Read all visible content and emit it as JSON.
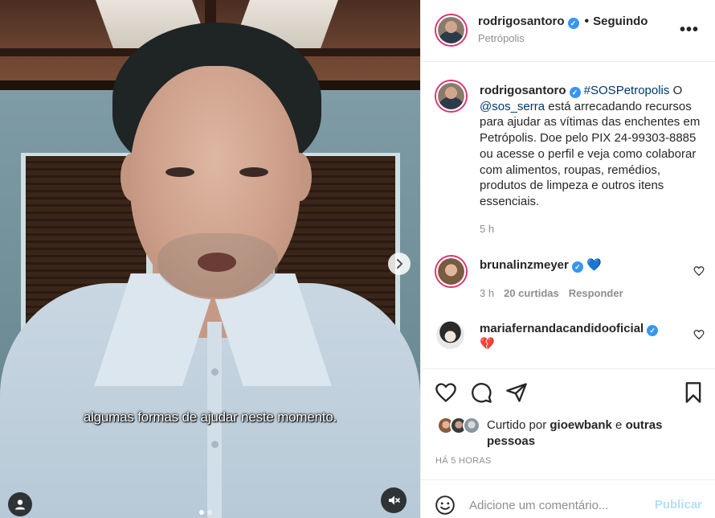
{
  "media": {
    "subtitle": "algumas formas de ajudar neste momento.",
    "next_icon": "chevron-right-icon",
    "user_tag_icon": "user-icon",
    "mute_icon": "speaker-muted-icon",
    "carousel_dots": 2
  },
  "header": {
    "username": "rodrigosantoro",
    "separator": "•",
    "follow_status": "Seguindo",
    "location": "Petrópolis",
    "more": "•••"
  },
  "caption": {
    "username": "rodrigosantoro",
    "hashtag": "#SOSPetropolis",
    "text_1": " O ",
    "mention": "@sos_serra",
    "text_2": " está arrecadando recursos para ajudar as vítimas das enchentes em Petrópolis. Doe pelo PIX 24-99303-8885 ou acesse o perfil e veja como colaborar com alimentos, roupas, remédios, produtos de limpeza e outros itens essenciais.",
    "time": "5 h"
  },
  "comments": [
    {
      "username": "brunalinzmeyer",
      "text": "💙",
      "time": "3 h",
      "likes": "20 curtidas",
      "reply": "Responder"
    },
    {
      "username": "mariafernandacandidooficial",
      "text": "💔"
    }
  ],
  "likes": {
    "prefix": "Curtido por ",
    "user": "gioewbank",
    "middle": " e ",
    "others": "outras pessoas"
  },
  "timestamp": "HÁ 5 HORAS",
  "composer": {
    "placeholder": "Adicione um comentário...",
    "publish": "Publicar"
  },
  "colors": {
    "link": "#00376b",
    "verified": "#3897f0",
    "publish_disabled": "#b2dffc",
    "secondary_text": "#8e8e8e"
  }
}
